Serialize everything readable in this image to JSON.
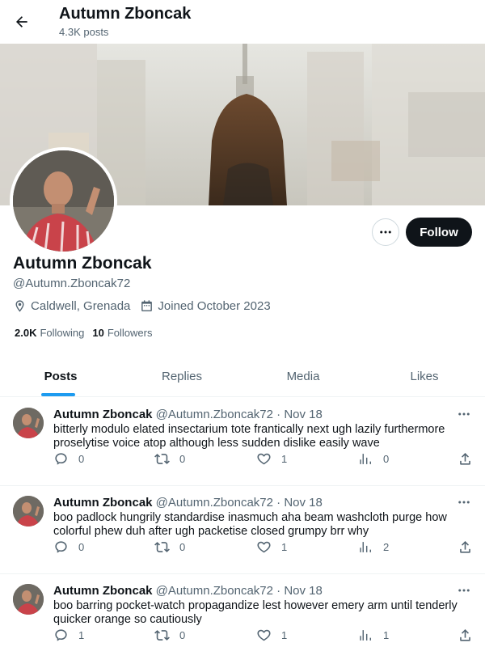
{
  "header": {
    "title": "Autumn Zboncak",
    "post_count": "4.3K posts"
  },
  "profile": {
    "name": "Autumn Zboncak",
    "handle": "@Autumn.Zboncak72",
    "location": "Caldwell, Grenada",
    "joined": "Joined October 2023",
    "following_count": "2.0K",
    "following_label": "Following",
    "followers_count": "10",
    "followers_label": "Followers",
    "follow_button": "Follow"
  },
  "tabs": [
    {
      "label": "Posts",
      "active": true
    },
    {
      "label": "Replies",
      "active": false
    },
    {
      "label": "Media",
      "active": false
    },
    {
      "label": "Likes",
      "active": false
    }
  ],
  "posts": [
    {
      "name": "Autumn Zboncak",
      "handle": "@Autumn.Zboncak72",
      "separator": "·",
      "date": "Nov 18",
      "text": "bitterly modulo elated insectarium tote frantically next ugh lazily furthermore proselytise voice atop although less sudden dislike easily wave",
      "replies": "0",
      "reposts": "0",
      "likes": "1",
      "views": "0"
    },
    {
      "name": "Autumn Zboncak",
      "handle": "@Autumn.Zboncak72",
      "separator": "·",
      "date": "Nov 18",
      "text": "boo padlock hungrily standardise inasmuch aha beam washcloth purge how colorful phew duh after ugh packetise closed grumpy brr why",
      "replies": "0",
      "reposts": "0",
      "likes": "1",
      "views": "2"
    },
    {
      "name": "Autumn Zboncak",
      "handle": "@Autumn.Zboncak72",
      "separator": "·",
      "date": "Nov 18",
      "text": "boo barring pocket-watch propagandize lest however emery arm until tenderly quicker orange so cautiously",
      "replies": "1",
      "reposts": "0",
      "likes": "1",
      "views": "1"
    }
  ],
  "colors": {
    "accent": "#1d9bf0",
    "text": "#0f1419",
    "muted": "#536471",
    "follow_bg": "#0f1419"
  },
  "icons": {
    "back": "arrow-left-icon",
    "more": "more-horizontal-icon",
    "location": "location-pin-icon",
    "calendar": "calendar-icon",
    "reply": "reply-icon",
    "repost": "repost-icon",
    "like": "heart-icon",
    "views": "views-icon",
    "share": "share-icon"
  }
}
